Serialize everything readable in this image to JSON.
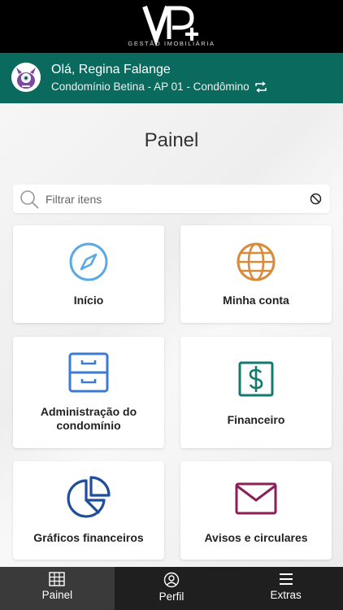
{
  "brand": {
    "tagline": "GESTÃO IMOBILIÁRIA",
    "logo_text": "VP+"
  },
  "user": {
    "greeting": "Olá, Regina Falange",
    "unit": "Condomínio Betina - AP 01 - Condômino"
  },
  "page": {
    "title": "Painel"
  },
  "search": {
    "placeholder": "Filtrar itens"
  },
  "cards": [
    {
      "label": "Início",
      "icon": "compass-icon",
      "color": "#5aa9e6"
    },
    {
      "label": "Minha conta",
      "icon": "globe-icon",
      "color": "#d98a3a"
    },
    {
      "label": "Administração do condomínio",
      "icon": "cabinet-icon",
      "color": "#3d7bd1"
    },
    {
      "label": "Financeiro",
      "icon": "dollar-icon",
      "color": "#137a6e"
    },
    {
      "label": "Gráficos financeiros",
      "icon": "pie-chart-icon",
      "color": "#1e4e9c"
    },
    {
      "label": "Avisos e circulares",
      "icon": "envelope-icon",
      "color": "#8b1f5a"
    }
  ],
  "nav": [
    {
      "label": "Painel",
      "icon": "grid-icon",
      "active": true
    },
    {
      "label": "Perfil",
      "icon": "user-circle-icon",
      "active": false
    },
    {
      "label": "Extras",
      "icon": "menu-icon",
      "active": false
    }
  ],
  "colors": {
    "header_bg": "#000000",
    "userbar_bg": "#0b6a5e",
    "nav_bg": "#1f1f1f"
  }
}
